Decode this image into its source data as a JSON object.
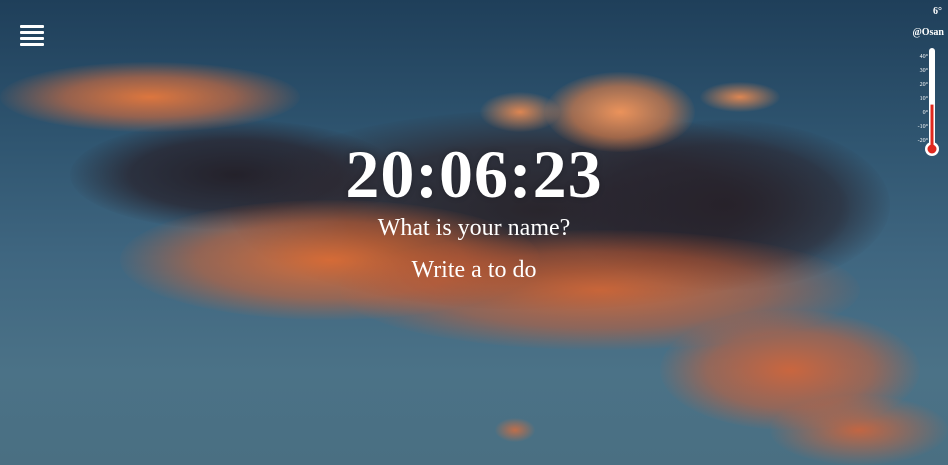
{
  "clock": {
    "time": "20:06:23"
  },
  "prompts": {
    "name_question": "What is your name?",
    "todo_prompt": "Write a to do"
  },
  "weather": {
    "temperature": "6°",
    "location": "@Osan",
    "scale_ticks": [
      "40°",
      "30°",
      "20°",
      "10°",
      "0°",
      "-10°",
      "-20°"
    ],
    "thermometer_level_celsius": 6,
    "mercury_color": "#e0281e"
  },
  "menu": {
    "icon": "hamburger-menu-icon"
  }
}
